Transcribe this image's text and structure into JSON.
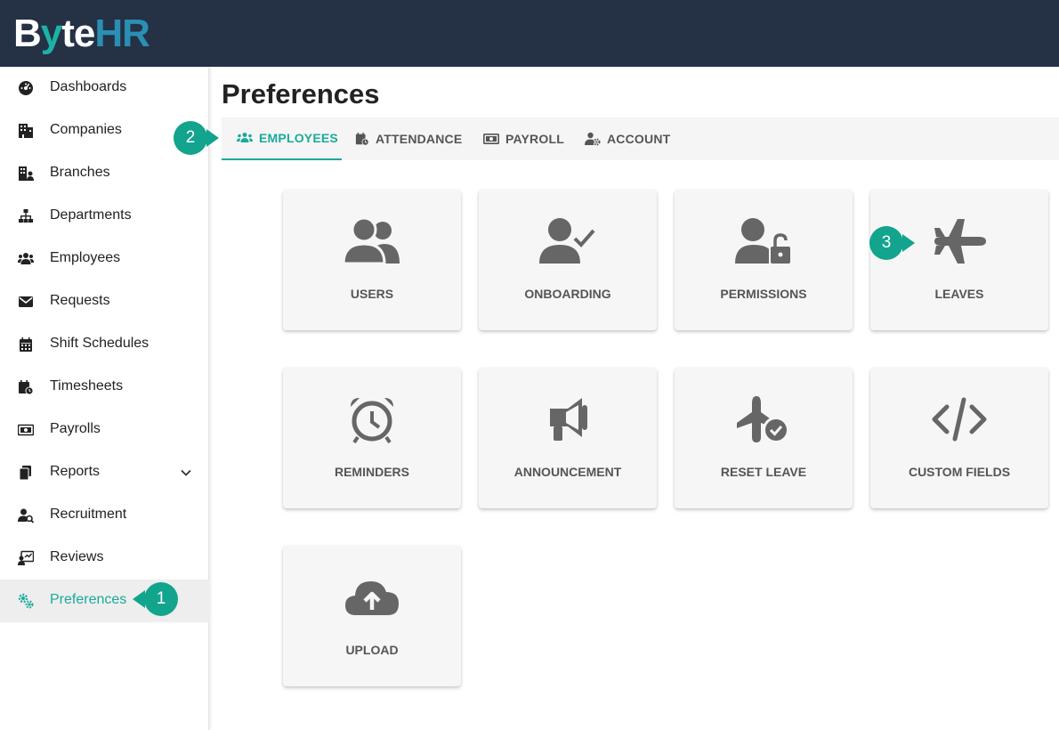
{
  "app": {
    "logo": {
      "b": "B",
      "y": "y",
      "te": "te",
      "hr": "HR"
    }
  },
  "sidebar": {
    "items": [
      {
        "label": "Dashboards",
        "icon": "dashboard-icon"
      },
      {
        "label": "Companies",
        "icon": "building-icon"
      },
      {
        "label": "Branches",
        "icon": "branch-icon"
      },
      {
        "label": "Departments",
        "icon": "sitemap-icon"
      },
      {
        "label": "Employees",
        "icon": "users-icon"
      },
      {
        "label": "Requests",
        "icon": "envelope-icon"
      },
      {
        "label": "Shift Schedules",
        "icon": "calendar-icon"
      },
      {
        "label": "Timesheets",
        "icon": "calendar-clock-icon"
      },
      {
        "label": "Payrolls",
        "icon": "money-icon"
      },
      {
        "label": "Reports",
        "icon": "file-icon"
      },
      {
        "label": "Recruitment",
        "icon": "user-search-icon"
      },
      {
        "label": "Reviews",
        "icon": "chalkboard-icon"
      },
      {
        "label": "Preferences",
        "icon": "gears-icon"
      }
    ],
    "active": "Preferences"
  },
  "main": {
    "title": "Preferences",
    "tabs": [
      {
        "label": "EMPLOYEES",
        "icon": "users-icon"
      },
      {
        "label": "ATTENDANCE",
        "icon": "calendar-clock-icon"
      },
      {
        "label": "PAYROLL",
        "icon": "money-icon"
      },
      {
        "label": "ACCOUNT",
        "icon": "user-gear-icon"
      }
    ],
    "active_tab": "EMPLOYEES",
    "cards": [
      {
        "label": "USERS",
        "icon": "users-icon"
      },
      {
        "label": "ONBOARDING",
        "icon": "user-check-icon"
      },
      {
        "label": "PERMISSIONS",
        "icon": "user-lock-icon"
      },
      {
        "label": "LEAVES",
        "icon": "plane-icon"
      },
      {
        "label": "REMINDERS",
        "icon": "alarm-clock-icon"
      },
      {
        "label": "ANNOUNCEMENT",
        "icon": "megaphone-icon"
      },
      {
        "label": "RESET LEAVE",
        "icon": "plane-check-icon"
      },
      {
        "label": "CUSTOM FIELDS",
        "icon": "code-icon"
      },
      {
        "label": "UPLOAD",
        "icon": "cloud-upload-icon"
      }
    ]
  },
  "callouts": [
    "1",
    "2",
    "3"
  ],
  "colors": {
    "accent": "#1aab9b",
    "header": "#253145",
    "callout": "#12a48d",
    "icon_gray": "#666666"
  }
}
